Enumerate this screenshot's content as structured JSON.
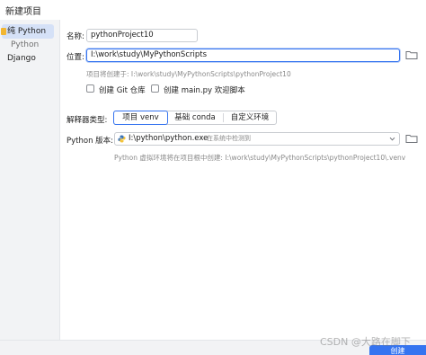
{
  "window": {
    "title": "新建项目"
  },
  "sidebar": {
    "items": [
      {
        "label": "纯 Python",
        "selected": true
      },
      {
        "label": "Python",
        "sub": true
      },
      {
        "label": "Django"
      }
    ]
  },
  "form": {
    "name_label": "名称:",
    "name_value": "pythonProject10",
    "location_label": "位置:",
    "location_value": "I:\\work\\study\\MyPythonScripts",
    "location_hint": "项目将创建于: I:\\work\\study\\MyPythonScripts\\pythonProject10",
    "git_label": "创建 Git 仓库",
    "main_label": "创建 main.py 欢迎脚本",
    "interpreter_label": "解释器类型:",
    "interpreter_options": [
      "项目 venv",
      "基础 conda",
      "自定义环境"
    ],
    "interpreter_selected": 0,
    "python_version_label": "Python 版本:",
    "python_path": "I:\\python\\python.exe",
    "python_note": "在系统中检测到",
    "venv_hint": "Python 虚拟环境将在项目根中创建: I:\\work\\study\\MyPythonScripts\\pythonProject10\\.venv"
  },
  "footer": {
    "create_label": "创建",
    "watermark": "CSDN @大路在脚下"
  },
  "colors": {
    "accent": "#3574f0",
    "sidebar_selected": "#d5e1f7"
  }
}
